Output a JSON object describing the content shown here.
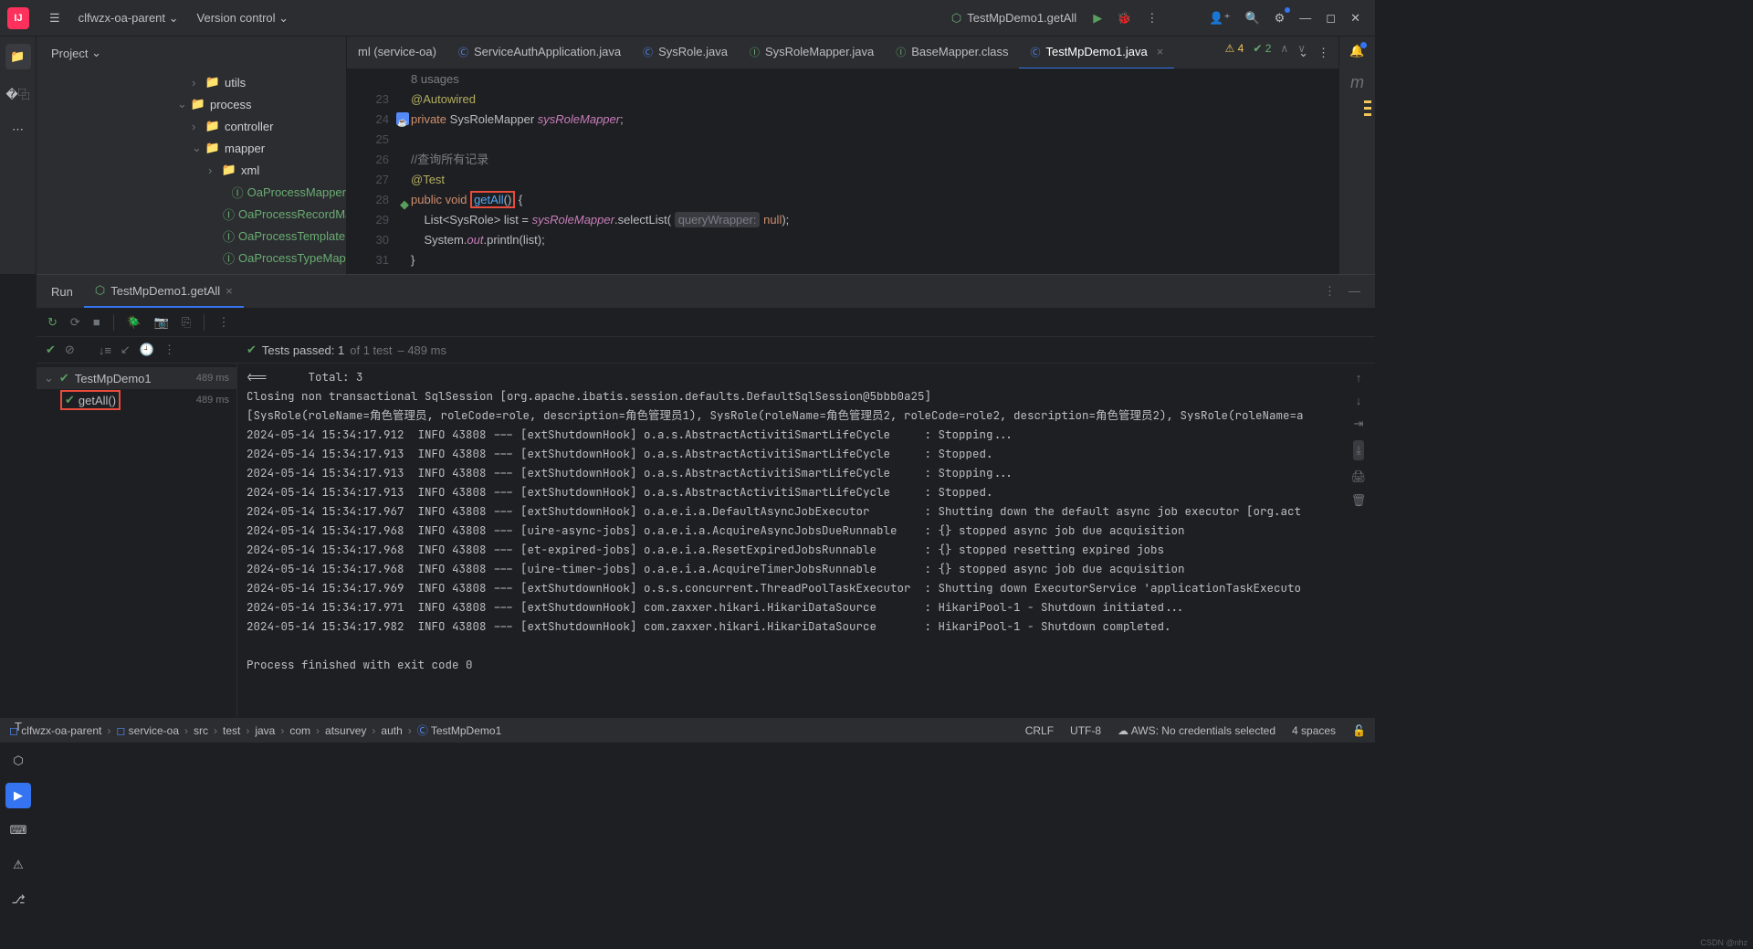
{
  "titlebar": {
    "project": "clfwzx-oa-parent",
    "vcs": "Version control",
    "run_config_icon": "⬡",
    "run_config": "TestMpDemo1.getAll"
  },
  "project_panel": {
    "title": "Project",
    "tree": [
      {
        "indent": 170,
        "chev": "›",
        "icon": "📁",
        "label": "utils",
        "cls": "folder"
      },
      {
        "indent": 154,
        "chev": "⌄",
        "icon": "📁",
        "label": "process",
        "cls": "folder"
      },
      {
        "indent": 170,
        "chev": "›",
        "icon": "📁",
        "label": "controller",
        "cls": "folder"
      },
      {
        "indent": 170,
        "chev": "⌄",
        "icon": "📁",
        "label": "mapper",
        "cls": "folder"
      },
      {
        "indent": 188,
        "chev": "›",
        "icon": "📁",
        "label": "xml",
        "cls": "folder"
      },
      {
        "indent": 204,
        "chev": "",
        "icon": "Ⓘ",
        "label": "OaProcessMapper",
        "cls": "iface"
      },
      {
        "indent": 204,
        "chev": "",
        "icon": "Ⓘ",
        "label": "OaProcessRecordMappe",
        "cls": "iface"
      },
      {
        "indent": 204,
        "chev": "",
        "icon": "Ⓘ",
        "label": "OaProcessTemplateMap",
        "cls": "iface"
      },
      {
        "indent": 204,
        "chev": "",
        "icon": "Ⓘ",
        "label": "OaProcessTypeMapper",
        "cls": "iface"
      }
    ]
  },
  "tabs": [
    {
      "icon": "",
      "label": "ml (service-oa)",
      "active": false
    },
    {
      "icon": "Ⓒ",
      "iconcls": "ticon-c",
      "label": "ServiceAuthApplication.java",
      "active": false
    },
    {
      "icon": "Ⓒ",
      "iconcls": "ticon-c",
      "label": "SysRole.java",
      "active": false
    },
    {
      "icon": "Ⓘ",
      "iconcls": "ticon-j",
      "label": "SysRoleMapper.java",
      "active": false
    },
    {
      "icon": "Ⓘ",
      "iconcls": "ticon-j",
      "label": "BaseMapper.class",
      "active": false
    },
    {
      "icon": "Ⓒ",
      "iconcls": "ticon-c",
      "label": "TestMpDemo1.java",
      "active": true
    }
  ],
  "inspection": {
    "warn": "4",
    "ok": "2"
  },
  "code": {
    "usages": "8 usages",
    "lines_start": 23,
    "getAll": "getAll",
    "param_hint": "queryWrapper:"
  },
  "run": {
    "label": "Run",
    "tab": "TestMpDemo1.getAll",
    "tests_passed": "Tests passed: 1",
    "tests_of": " of 1 test",
    "tests_dur": " – 489 ms",
    "tree": [
      {
        "chev": "⌄",
        "label": "TestMpDemo1",
        "dur": "489 ms",
        "sel": true
      },
      {
        "chev": "",
        "label": "getAll()",
        "dur": "489 ms",
        "sel": false,
        "hl": true
      }
    ],
    "console": "<==      Total: 3\nClosing non transactional SqlSession [org.apache.ibatis.session.defaults.DefaultSqlSession@5bbb0a25]\n[SysRole(roleName=角色管理员, roleCode=role, description=角色管理员1), SysRole(roleName=角色管理员2, roleCode=role2, description=角色管理员2), SysRole(roleName=a\n2024-05-14 15:34:17.912  INFO 43808 --- [extShutdownHook] o.a.s.AbstractActivitiSmartLifeCycle     : Stopping...\n2024-05-14 15:34:17.913  INFO 43808 --- [extShutdownHook] o.a.s.AbstractActivitiSmartLifeCycle     : Stopped.\n2024-05-14 15:34:17.913  INFO 43808 --- [extShutdownHook] o.a.s.AbstractActivitiSmartLifeCycle     : Stopping...\n2024-05-14 15:34:17.913  INFO 43808 --- [extShutdownHook] o.a.s.AbstractActivitiSmartLifeCycle     : Stopped.\n2024-05-14 15:34:17.967  INFO 43808 --- [extShutdownHook] o.a.e.i.a.DefaultAsyncJobExecutor        : Shutting down the default async job executor [org.act\n2024-05-14 15:34:17.968  INFO 43808 --- [uire-async-jobs] o.a.e.i.a.AcquireAsyncJobsDueRunnable    : {} stopped async job due acquisition\n2024-05-14 15:34:17.968  INFO 43808 --- [et-expired-jobs] o.a.e.i.a.ResetExpiredJobsRunnable       : {} stopped resetting expired jobs\n2024-05-14 15:34:17.968  INFO 43808 --- [uire-timer-jobs] o.a.e.i.a.AcquireTimerJobsRunnable       : {} stopped async job due acquisition\n2024-05-14 15:34:17.969  INFO 43808 --- [extShutdownHook] o.s.s.concurrent.ThreadPoolTaskExecutor  : Shutting down ExecutorService 'applicationTaskExecuto\n2024-05-14 15:34:17.971  INFO 43808 --- [extShutdownHook] com.zaxxer.hikari.HikariDataSource       : HikariPool-1 - Shutdown initiated...\n2024-05-14 15:34:17.982  INFO 43808 --- [extShutdownHook] com.zaxxer.hikari.HikariDataSource       : HikariPool-1 - Shutdown completed.\n\nProcess finished with exit code 0"
  },
  "breadcrumb": [
    "clfwzx-oa-parent",
    "service-oa",
    "src",
    "test",
    "java",
    "com",
    "atsurvey",
    "auth",
    "TestMpDemo1"
  ],
  "status": {
    "crlf": "CRLF",
    "enc": "UTF-8",
    "aws": "AWS: No credentials selected",
    "indent": "4 spaces"
  },
  "watermark": "CSDN @nhz"
}
